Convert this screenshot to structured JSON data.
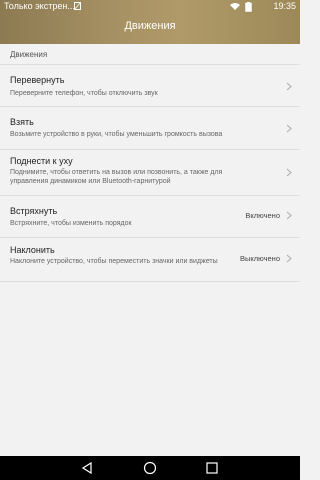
{
  "status_bar": {
    "carrier": "Только экстрен...",
    "time": "19:35",
    "icons": [
      "sim-icon",
      "wifi-icon",
      "battery-icon"
    ]
  },
  "header": {
    "title": "Движения"
  },
  "section": {
    "title": "Движения"
  },
  "items": [
    {
      "label": "Перевернуть",
      "desc": "Переверните телефон, чтобы отключить звук",
      "value": ""
    },
    {
      "label": "Взять",
      "desc": "Возьмите устройство в руки, чтобы уменьшить громкость вызова",
      "value": ""
    },
    {
      "label": "Поднести к уху",
      "desc": "Поднимите, чтобы ответить на вызов или позвонить, а также для управления динамиком или Bluetooth-гарнитурой",
      "value": ""
    },
    {
      "label": "Встряхнуть",
      "desc": "Встряхните, чтобы изменить порядок",
      "value": "Включено"
    },
    {
      "label": "Наклонить",
      "desc": "Наклоните устройство, чтобы переместить значки или виджеты",
      "value": "Выключено"
    }
  ],
  "navbar": {
    "icons": [
      "back-icon",
      "home-icon",
      "recents-icon"
    ]
  },
  "colors": {
    "header": "#a48f62",
    "background": "#f2f2f2",
    "navbar": "#000000"
  }
}
